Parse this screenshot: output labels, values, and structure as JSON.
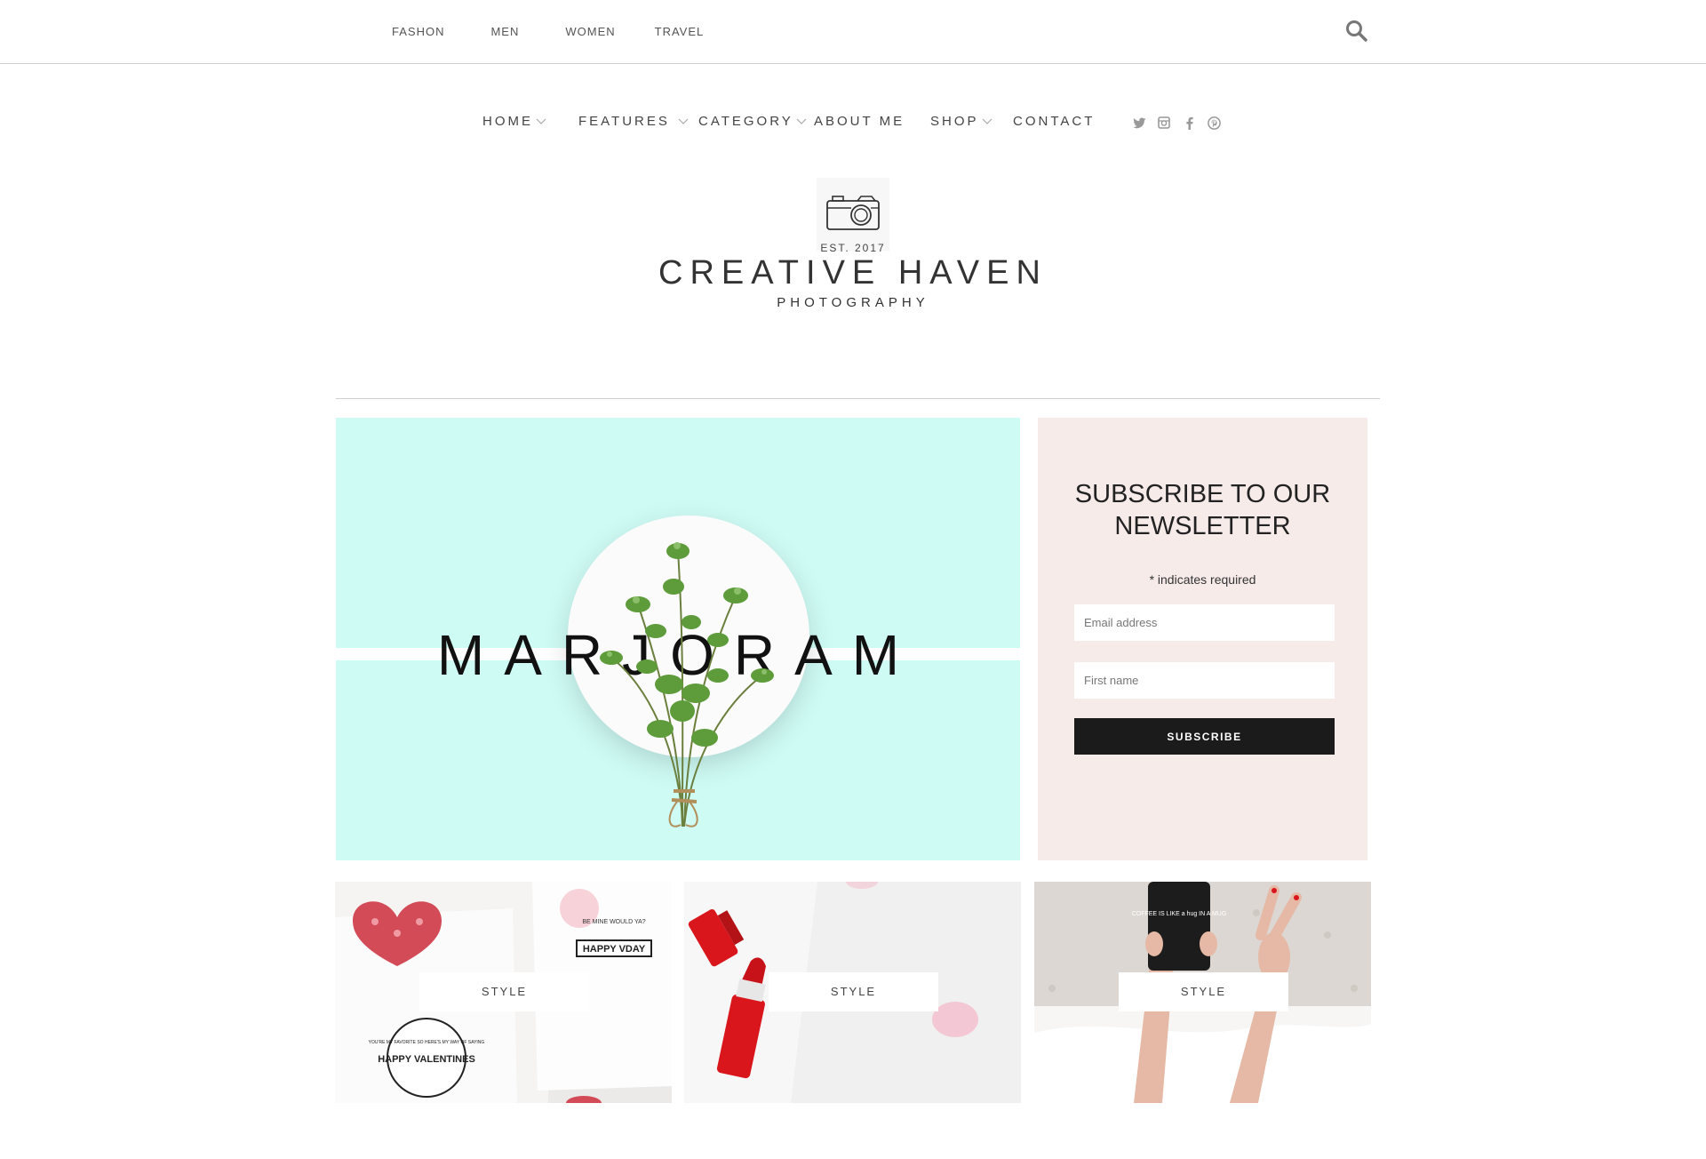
{
  "topbar": {
    "links": [
      "FASHON",
      "MEN",
      "WOMEN",
      "TRAVEL"
    ]
  },
  "mainnav": {
    "items": [
      {
        "label": "HOME",
        "dropdown": true
      },
      {
        "label": "FEATURES",
        "dropdown": true
      },
      {
        "label": "CATEGORY",
        "dropdown": true
      },
      {
        "label": "ABOUT ME",
        "dropdown": false
      },
      {
        "label": "SHOP",
        "dropdown": true
      },
      {
        "label": "CONTACT",
        "dropdown": false
      }
    ],
    "social_icons": [
      "twitter-icon",
      "instagram-icon",
      "facebook-icon",
      "pinterest-icon"
    ]
  },
  "logo": {
    "est": "EST. 2017",
    "title": "CREATIVE HAVEN",
    "subtitle": "PHOTOGRAPHY"
  },
  "hero": {
    "word": "MARJORAM",
    "background": "#cffbf5"
  },
  "newsletter": {
    "title": "SUBSCRIBE TO OUR NEWSLETTER",
    "required_note": "* indicates required",
    "email_placeholder": "Email address",
    "firstname_placeholder": "First name",
    "button_label": "SUBSCRIBE",
    "background": "#f7ebea"
  },
  "cards": [
    {
      "label": "STYLE",
      "texts": [
        "BE MINE WOULD YA?",
        "HAPPY VDAY",
        "YOU'RE MY FAVORITE SO HERE'S MY WAY OF SAYING",
        "HAPPY VALENTINES"
      ]
    },
    {
      "label": "STYLE"
    },
    {
      "label": "STYLE",
      "texts": [
        "COFFEE IS LIKE a hug IN A MUG"
      ]
    }
  ],
  "colors": {
    "accent_dark": "#1b1b1b",
    "lipstick_red": "#d8161c"
  }
}
